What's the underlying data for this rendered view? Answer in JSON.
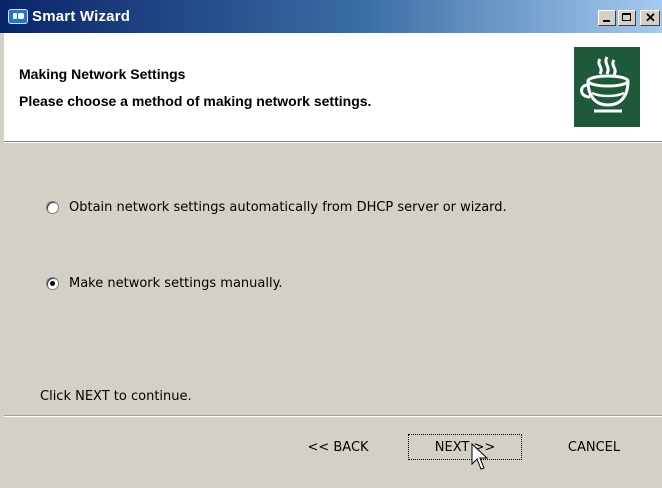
{
  "window": {
    "title": "Smart Wizard",
    "icon": "app-icon",
    "controls": [
      "minimize-icon",
      "maximize-icon",
      "close-icon"
    ]
  },
  "header": {
    "title": "Making Network Settings",
    "subtitle": "Please choose a method of making network settings.",
    "logo": "teapot-logo-icon",
    "logo_color": "#1e5a3a"
  },
  "options": [
    {
      "label": "Obtain network settings automatically from DHCP server or wizard.",
      "selected": false
    },
    {
      "label": "Make network settings manually.",
      "selected": true
    }
  ],
  "hint": "Click NEXT to continue.",
  "buttons": {
    "back": "<< BACK",
    "next": "NEXT >>",
    "cancel": "CANCEL"
  },
  "colors": {
    "dialog_bg": "#d4d0c8",
    "titlebar_start": "#0a246a",
    "titlebar_end": "#a6caf0"
  }
}
